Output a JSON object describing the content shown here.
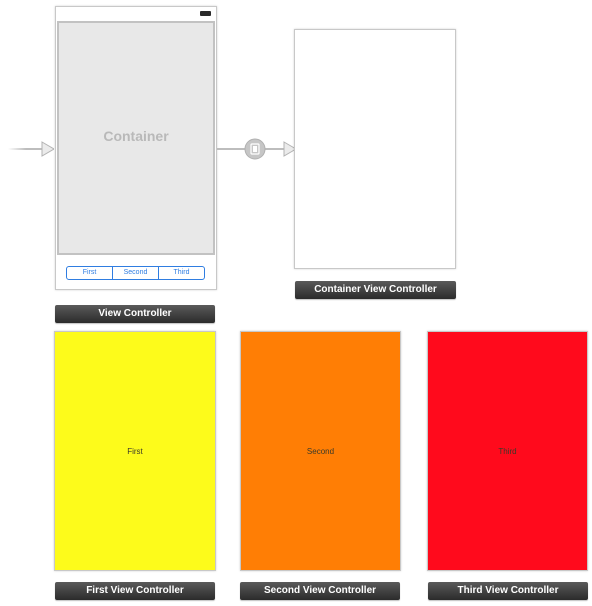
{
  "scenes": {
    "main": {
      "title": "View Controller",
      "container_label": "Container",
      "segments": [
        "First",
        "Second",
        "Third"
      ]
    },
    "container": {
      "title": "Container View Controller"
    },
    "first": {
      "title": "First View Controller",
      "text": "First",
      "color": "#fdfb1b"
    },
    "second": {
      "title": "Second View Controller",
      "text": "Second",
      "color": "#ff7e05"
    },
    "third": {
      "title": "Third View Controller",
      "text": "Third",
      "color": "#ff0a1c"
    }
  },
  "segues": {
    "initial_arrow_icon": "entry-arrow-icon",
    "embed_segue_icon": "embed-segue-icon"
  },
  "colors": {
    "segment_tint": "#2f7de1",
    "container_fill": "#e8e8e8",
    "label_bar": "#3a3a3a"
  }
}
